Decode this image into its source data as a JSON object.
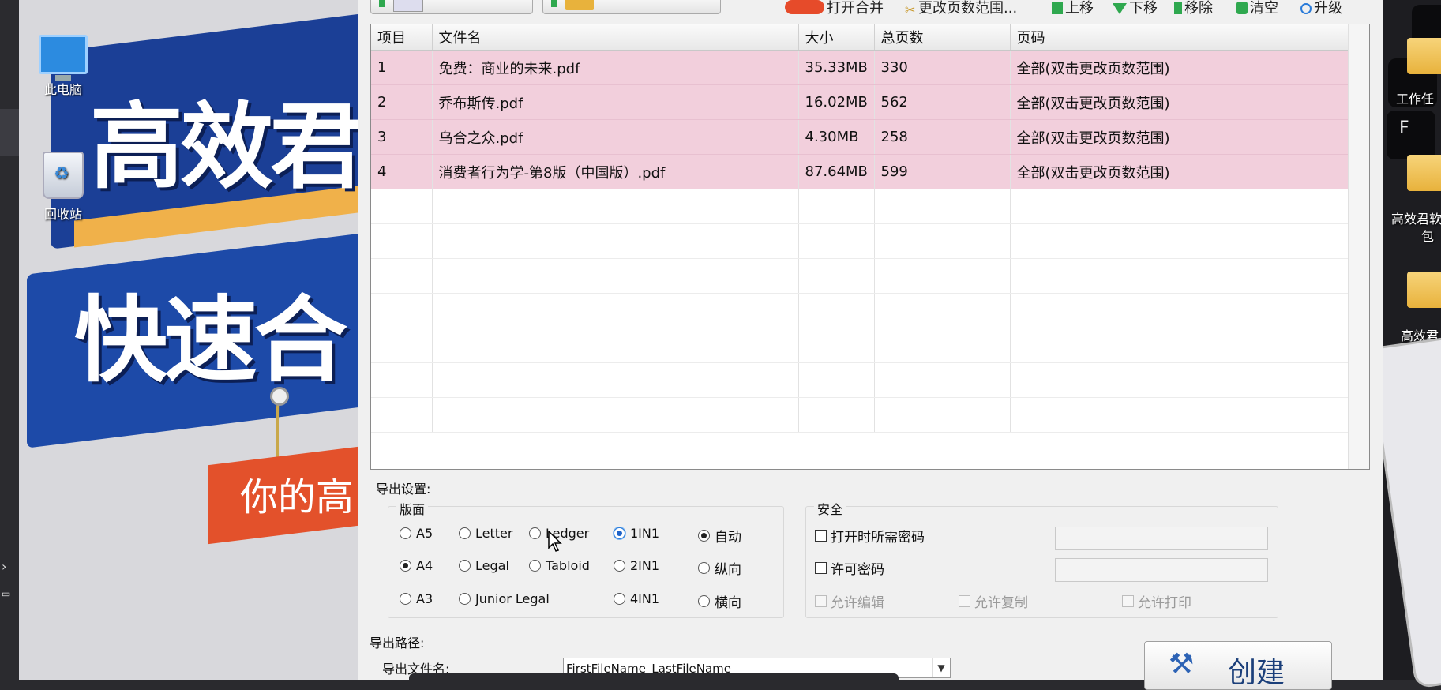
{
  "desktop": {
    "icons": [
      {
        "label": "此电脑",
        "icon": "computer-icon"
      },
      {
        "label": "回收站",
        "icon": "recycle-bin-icon"
      }
    ],
    "banner_line1": "高效君",
    "banner_line2": "快速合",
    "ribbon_text": "你的高",
    "right_icons": [
      {
        "label": "工作任",
        "icon": "folder-icon"
      },
      {
        "label": "高效君软",
        "icon": "folder-icon"
      },
      {
        "label": "包",
        "icon": "folder-icon"
      },
      {
        "label": "高效君",
        "icon": "folder-icon"
      }
    ],
    "key_label": "F"
  },
  "toolbar": {
    "items": [
      {
        "label": "打开合并",
        "icon": "toggle-icon",
        "color": "#e64b2a"
      },
      {
        "label": "更改页数范围...",
        "icon": "scissors-icon",
        "color": "#c99a2e"
      },
      {
        "label": "上移",
        "icon": "up-arrow-icon",
        "color": "#2fa84f"
      },
      {
        "label": "下移",
        "icon": "down-arrow-icon",
        "color": "#2fa84f"
      },
      {
        "label": "移除",
        "icon": "remove-icon",
        "color": "#2fa84f"
      },
      {
        "label": "清空",
        "icon": "clear-icon",
        "color": "#2fa84f"
      },
      {
        "label": "升级",
        "icon": "upgrade-icon",
        "color": "#2a7bd9"
      }
    ]
  },
  "file_list": {
    "columns": [
      "项目",
      "文件名",
      "大小",
      "总页数",
      "页码"
    ],
    "rows": [
      {
        "index": "1",
        "name": "免费：商业的未来.pdf",
        "size": "35.33MB",
        "pages": "330",
        "range": "全部(双击更改页数范围)"
      },
      {
        "index": "2",
        "name": "乔布斯传.pdf",
        "size": "16.02MB",
        "pages": "562",
        "range": "全部(双击更改页数范围)"
      },
      {
        "index": "3",
        "name": "乌合之众.pdf",
        "size": "4.30MB",
        "pages": "258",
        "range": "全部(双击更改页数范围)"
      },
      {
        "index": "4",
        "name": "消费者行为学-第8版（中国版）.pdf",
        "size": "87.64MB",
        "pages": "599",
        "range": "全部(双击更改页数范围)"
      }
    ],
    "selected_color": "#f2cfdc"
  },
  "export_settings": {
    "title": "导出设置:",
    "layout_group": "版面",
    "page_sizes": [
      {
        "label": "A5",
        "checked": false
      },
      {
        "label": "Letter",
        "checked": false
      },
      {
        "label": "Ledger",
        "checked": false
      },
      {
        "label": "A4",
        "checked": true
      },
      {
        "label": "Legal",
        "checked": false
      },
      {
        "label": "Tabloid",
        "checked": false
      },
      {
        "label": "A3",
        "checked": false
      },
      {
        "label": "Junior Legal",
        "checked": false
      }
    ],
    "nup": [
      {
        "label": "1IN1",
        "checked": true
      },
      {
        "label": "2IN1",
        "checked": false
      },
      {
        "label": "4IN1",
        "checked": false
      }
    ],
    "orientation": [
      {
        "label": "自动",
        "checked": true
      },
      {
        "label": "纵向",
        "checked": false
      },
      {
        "label": "横向",
        "checked": false
      }
    ],
    "security_group": "安全",
    "open_password": "打开时所需密码",
    "permission_password": "许可密码",
    "allow_edit": "允许编辑",
    "allow_copy": "允许复制",
    "allow_print": "允许打印"
  },
  "output": {
    "path_label": "导出路径:",
    "filename_label": "导出文件名:",
    "filename_value": "FirstFileName_LastFileName",
    "create_label": "创建"
  }
}
